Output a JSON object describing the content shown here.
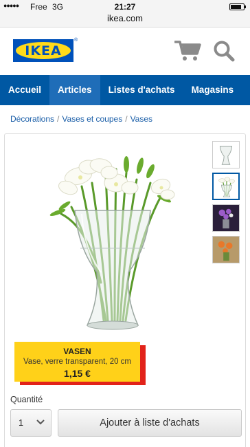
{
  "status_bar": {
    "signal": "●●●●●",
    "carrier": "Free",
    "network": "3G",
    "time": "21:27",
    "battery_level": 0.85
  },
  "url": "ikea.com",
  "header": {
    "logo_text": "IKEA",
    "logo_reg": "®",
    "brand_blue": "#0058a3",
    "brand_yellow": "#ffda1a"
  },
  "nav": {
    "items": [
      {
        "label": "Accueil"
      },
      {
        "label": "Articles"
      },
      {
        "label": "Listes d'achats"
      },
      {
        "label": "Magasins"
      }
    ],
    "active": "Articles"
  },
  "breadcrumb": {
    "items": [
      {
        "label": "Décorations"
      },
      {
        "label": "Vases et coupes"
      },
      {
        "label": "Vases"
      }
    ],
    "separator": "/"
  },
  "product": {
    "name": "VASEN",
    "description": "Vase, verre transparent, 20 cm",
    "price": "1,15 €",
    "thumbnails": [
      "vase-empty",
      "vase-with-freesia",
      "vase-purple-flowers",
      "vase-orange-flowers"
    ],
    "selected_thumbnail": 1
  },
  "quantity": {
    "label": "Quantité",
    "value": "1"
  },
  "add_button_label": "Ajouter à liste d'achats"
}
